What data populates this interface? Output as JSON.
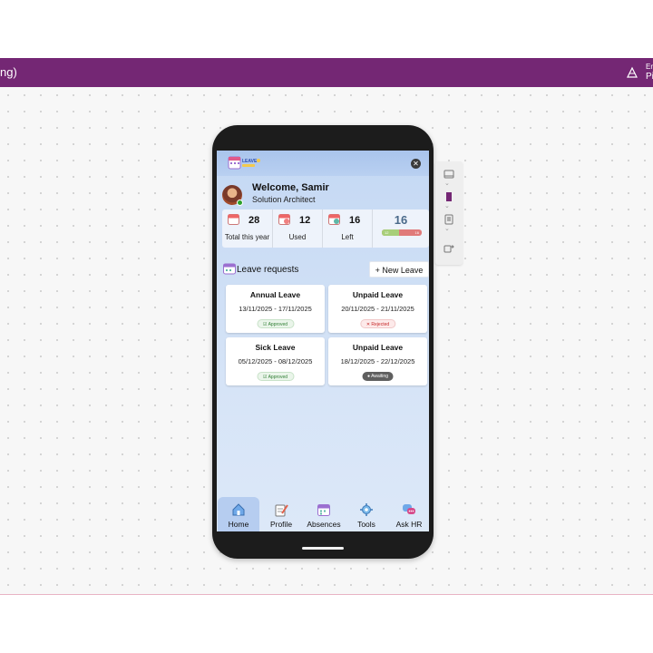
{
  "topbar": {
    "title": "ng)",
    "env_line1": "Er",
    "env_line2": "Pi",
    "bg": "#742774"
  },
  "app": {
    "logo_label": "LEAVE",
    "welcome": "Welcome, Samir",
    "role": "Solution Architect",
    "stats": [
      {
        "value": "28",
        "label": "Total this year"
      },
      {
        "value": "12",
        "label": "Used"
      },
      {
        "value": "16",
        "label": "Left"
      }
    ],
    "remaining_big": "16",
    "bar": {
      "used_label": "12",
      "left_label": "16",
      "used_fraction": 0.43
    },
    "requests_title": "Leave requests",
    "new_leave_label": "+ New Leave",
    "requests": [
      {
        "type": "Annual Leave",
        "dates": "13/11/2025 - 17/11/2025",
        "status": "Approved",
        "status_kind": "approved"
      },
      {
        "type": "Unpaid Leave",
        "dates": "20/11/2025 - 21/11/2025",
        "status": "Rejected",
        "status_kind": "rejected"
      },
      {
        "type": "Sick Leave",
        "dates": "05/12/2025 - 08/12/2025",
        "status": "Approved",
        "status_kind": "approved"
      },
      {
        "type": "Unpaid Leave",
        "dates": "18/12/2025 - 22/12/2025",
        "status": "Awaiting",
        "status_kind": "awaiting"
      }
    ],
    "nav": [
      {
        "label": "Home",
        "icon": "home-icon",
        "active": true
      },
      {
        "label": "Profile",
        "icon": "profile-edit-icon"
      },
      {
        "label": "Absences",
        "icon": "calendar-icon"
      },
      {
        "label": "Tools",
        "icon": "tools-icon"
      },
      {
        "label": "Ask HR",
        "icon": "chat-icon"
      }
    ]
  },
  "colors": {
    "accent": "#742774",
    "approved": "#2e7d32",
    "rejected": "#c62828",
    "awaiting": "#5f5f5f"
  }
}
